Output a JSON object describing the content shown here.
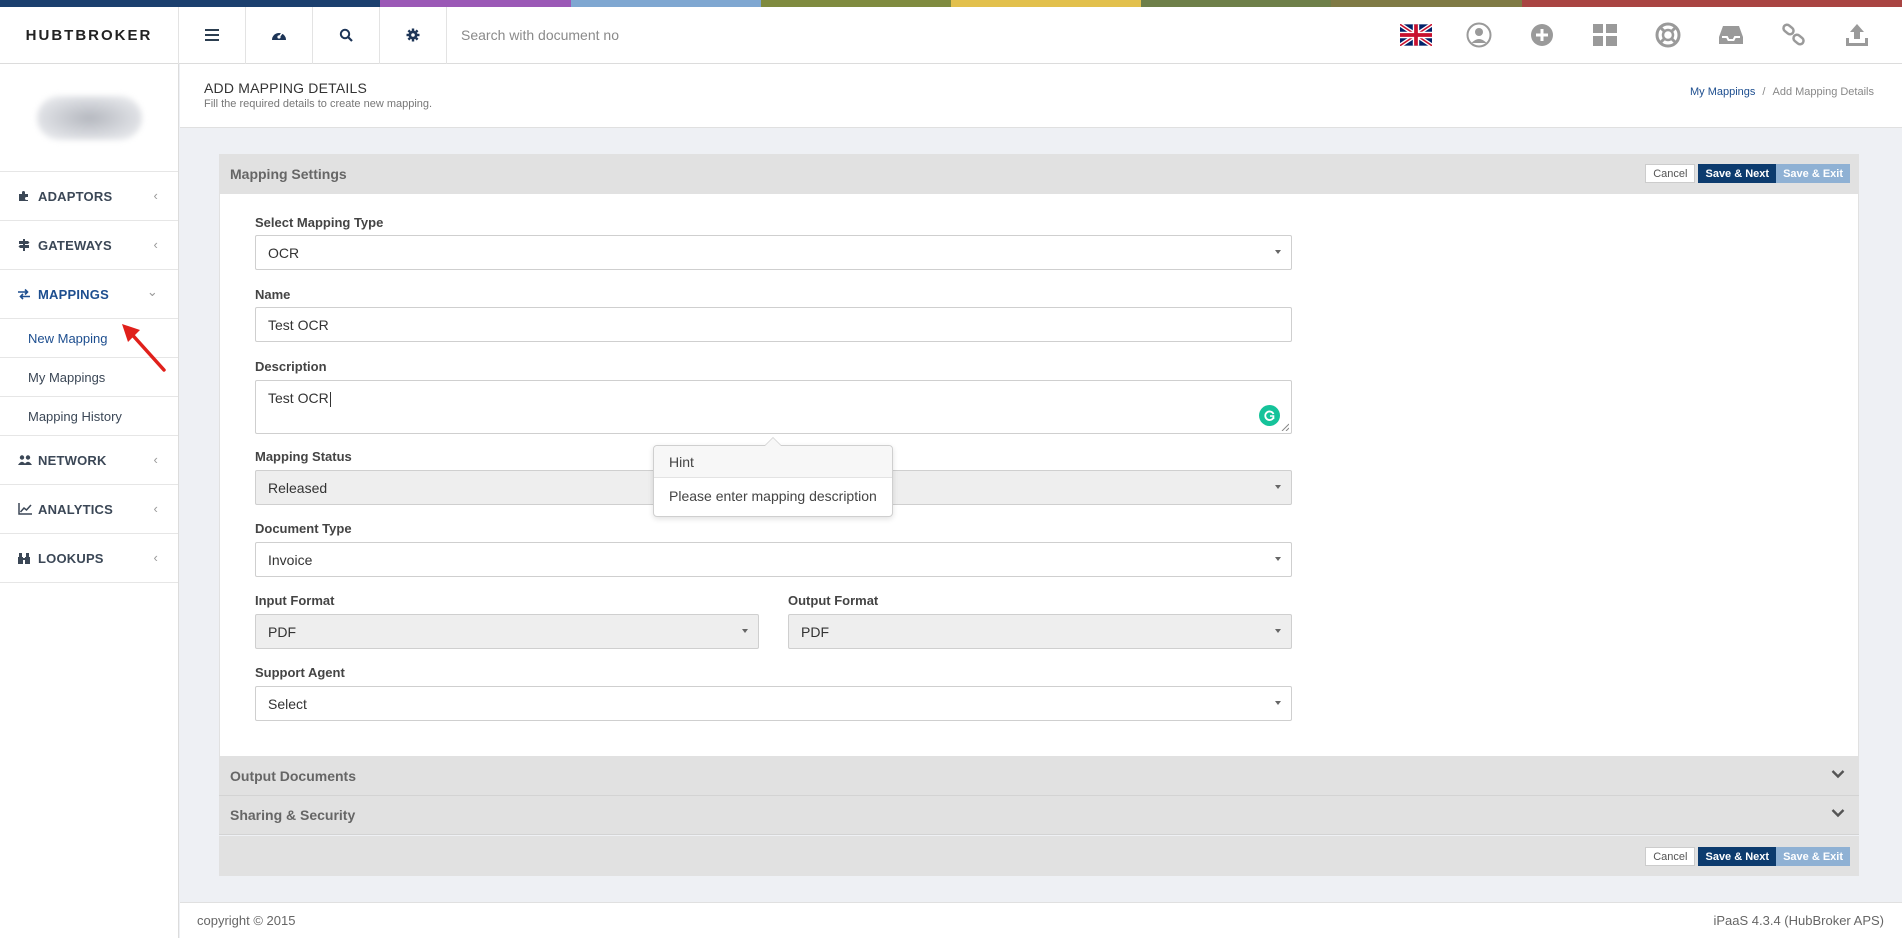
{
  "colors": {
    "strip": [
      "#1b3f6e",
      "#1b3f6e",
      "#9b59b6",
      "#7fa7d1",
      "#7f8b3f",
      "#e2c04d",
      "#6e7f49",
      "#7f7a45",
      "#a94442",
      "#a94442"
    ],
    "primary": "#0c3b6e",
    "secondary_button": "#8fb1d4",
    "accent_link": "#1d4e8f",
    "grammarly": "#15c39a",
    "annotation": "#e0201b"
  },
  "header": {
    "logo": "HUBTBROKER",
    "buttons": [
      "menu-icon",
      "dashboard-icon",
      "search-icon",
      "settings-icon"
    ],
    "search_placeholder": "Search with document no",
    "right_icons": [
      "uk-flag-icon",
      "user-icon",
      "add-circle-icon",
      "apps-grid-icon",
      "help-lifebuoy-icon",
      "inbox-icon",
      "link-icon",
      "upload-icon"
    ]
  },
  "sidebar": {
    "items": [
      {
        "label": "ADAPTORS",
        "icon": "puzzle-icon"
      },
      {
        "label": "GATEWAYS",
        "icon": "signpost-icon"
      },
      {
        "label": "MAPPINGS",
        "icon": "exchange-icon"
      },
      {
        "label": "NETWORK",
        "icon": "users-icon"
      },
      {
        "label": "ANALYTICS",
        "icon": "line-chart-icon"
      },
      {
        "label": "LOOKUPS",
        "icon": "binoculars-icon"
      }
    ],
    "sub_items": [
      "New Mapping",
      "My Mappings",
      "Mapping History"
    ]
  },
  "page": {
    "title": "ADD MAPPING DETAILS",
    "subtitle": "Fill the required details to create new mapping.",
    "breadcrumb": {
      "link": "My Mappings",
      "separator": "/",
      "current": "Add Mapping Details"
    }
  },
  "panel": {
    "title": "Mapping Settings",
    "cancel": "Cancel",
    "save_next": "Save & Next",
    "save_exit": "Save & Exit"
  },
  "form": {
    "mapping_type": {
      "label": "Select Mapping Type",
      "value": "OCR"
    },
    "name": {
      "label": "Name",
      "value": "Test OCR"
    },
    "description": {
      "label": "Description",
      "value": "Test OCR"
    },
    "status": {
      "label": "Mapping Status",
      "value": "Released"
    },
    "document_type": {
      "label": "Document Type",
      "value": "Invoice"
    },
    "input_format": {
      "label": "Input Format",
      "value": "PDF"
    },
    "output_format": {
      "label": "Output Format",
      "value": "PDF"
    },
    "support_agent": {
      "label": "Support Agent",
      "value": "Select"
    }
  },
  "hint": {
    "title": "Hint",
    "body": "Please enter mapping description"
  },
  "sections": [
    "Output Documents",
    "Sharing & Security"
  ],
  "footer": {
    "copyright": "copyright © 2015",
    "version": "iPaaS 4.3.4 (HubBroker APS)"
  }
}
